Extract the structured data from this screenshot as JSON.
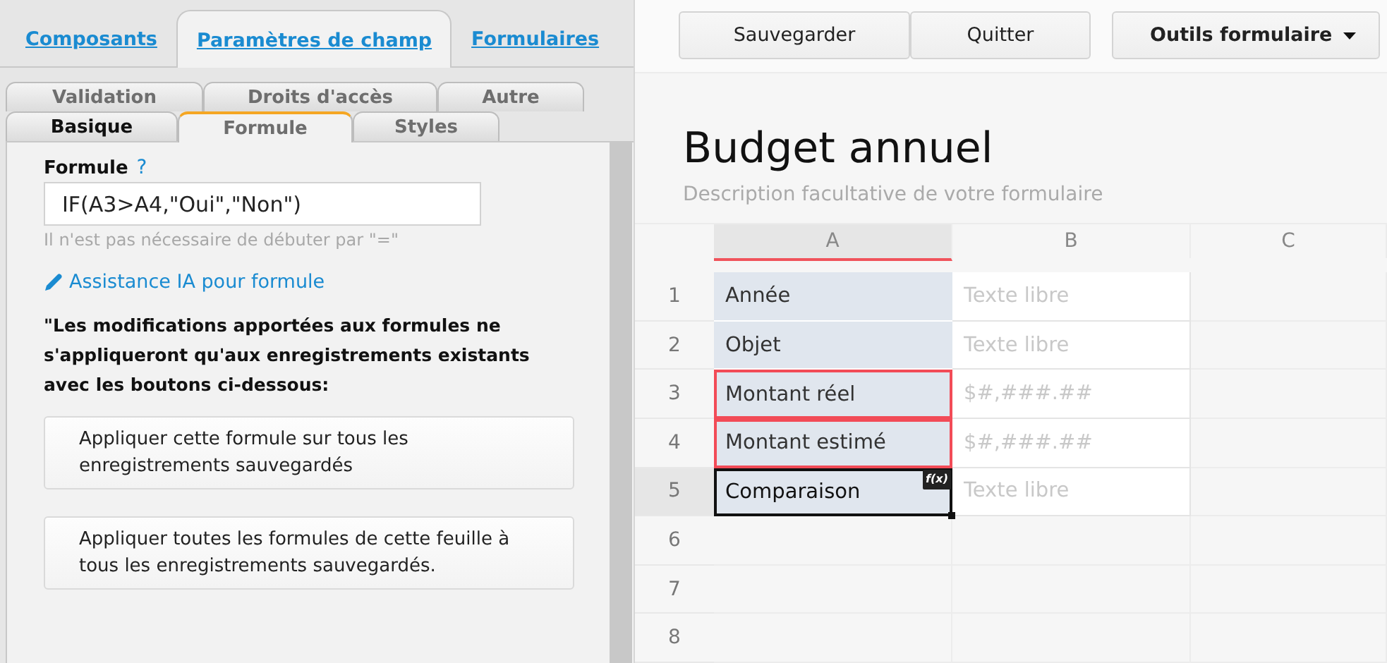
{
  "main_tabs": [
    {
      "label": "Composants",
      "selected": false
    },
    {
      "label": "Paramètres de champ",
      "selected": true
    },
    {
      "label": "Formulaires",
      "selected": false
    }
  ],
  "sub_tabs": [
    [
      {
        "label": "Validation",
        "selected": false,
        "highlighted": false
      },
      {
        "label": "Droits d'accès",
        "selected": false,
        "highlighted": false
      },
      {
        "label": "Autre",
        "selected": false,
        "highlighted": false
      }
    ],
    [
      {
        "label": "Basique",
        "selected": false,
        "highlighted": true
      },
      {
        "label": "Formule",
        "selected": true,
        "highlighted": false
      },
      {
        "label": "Styles",
        "selected": false,
        "highlighted": false
      }
    ]
  ],
  "formula": {
    "label": "Formule",
    "help": "?",
    "value": "IF(A3>A4,\"Oui\",\"Non\")",
    "hint": "Il n'est pas nécessaire de débuter par \"=\"",
    "ai_link": "Assistance IA pour formule",
    "warning": "\"Les modifications apportées aux formules ne s'appliqueront qu'aux enregistrements existants avec les boutons ci-dessous:",
    "buttons": [
      "Appliquer cette formule sur tous les enregistrements sauvegardés",
      "Appliquer toutes les formules de cette feuille à tous les enregistrements sauvegardés."
    ]
  },
  "toolbar": {
    "buttons": [
      "Sauvegarder",
      "Quitter"
    ],
    "menu": "Outils formulaire"
  },
  "form": {
    "title": "Budget annuel",
    "description": "Description facultative de votre formulaire"
  },
  "sheet": {
    "columns": [
      {
        "label": "A",
        "selected": true
      },
      {
        "label": "B",
        "selected": false
      },
      {
        "label": "C",
        "selected": false
      }
    ],
    "rows": [
      {
        "number": "1",
        "selected": false,
        "cells": [
          {
            "text": "Année",
            "referenced": false,
            "selected": false
          },
          {
            "placeholder": "Texte libre"
          }
        ]
      },
      {
        "number": "2",
        "selected": false,
        "cells": [
          {
            "text": "Objet",
            "referenced": false,
            "selected": false
          },
          {
            "placeholder": "Texte libre"
          }
        ]
      },
      {
        "number": "3",
        "selected": false,
        "cells": [
          {
            "text": "Montant réel",
            "referenced": true,
            "selected": false
          },
          {
            "placeholder": "$#,###.##"
          }
        ]
      },
      {
        "number": "4",
        "selected": false,
        "cells": [
          {
            "text": "Montant estimé",
            "referenced": true,
            "selected": false
          },
          {
            "placeholder": "$#,###.##"
          }
        ]
      },
      {
        "number": "5",
        "selected": true,
        "cells": [
          {
            "text": "Comparaison",
            "referenced": false,
            "selected": true,
            "badge": "f(x)"
          },
          {
            "placeholder": "Texte libre"
          }
        ]
      },
      {
        "number": "6",
        "selected": false
      },
      {
        "number": "7",
        "selected": false
      },
      {
        "number": "8",
        "selected": false
      }
    ]
  }
}
